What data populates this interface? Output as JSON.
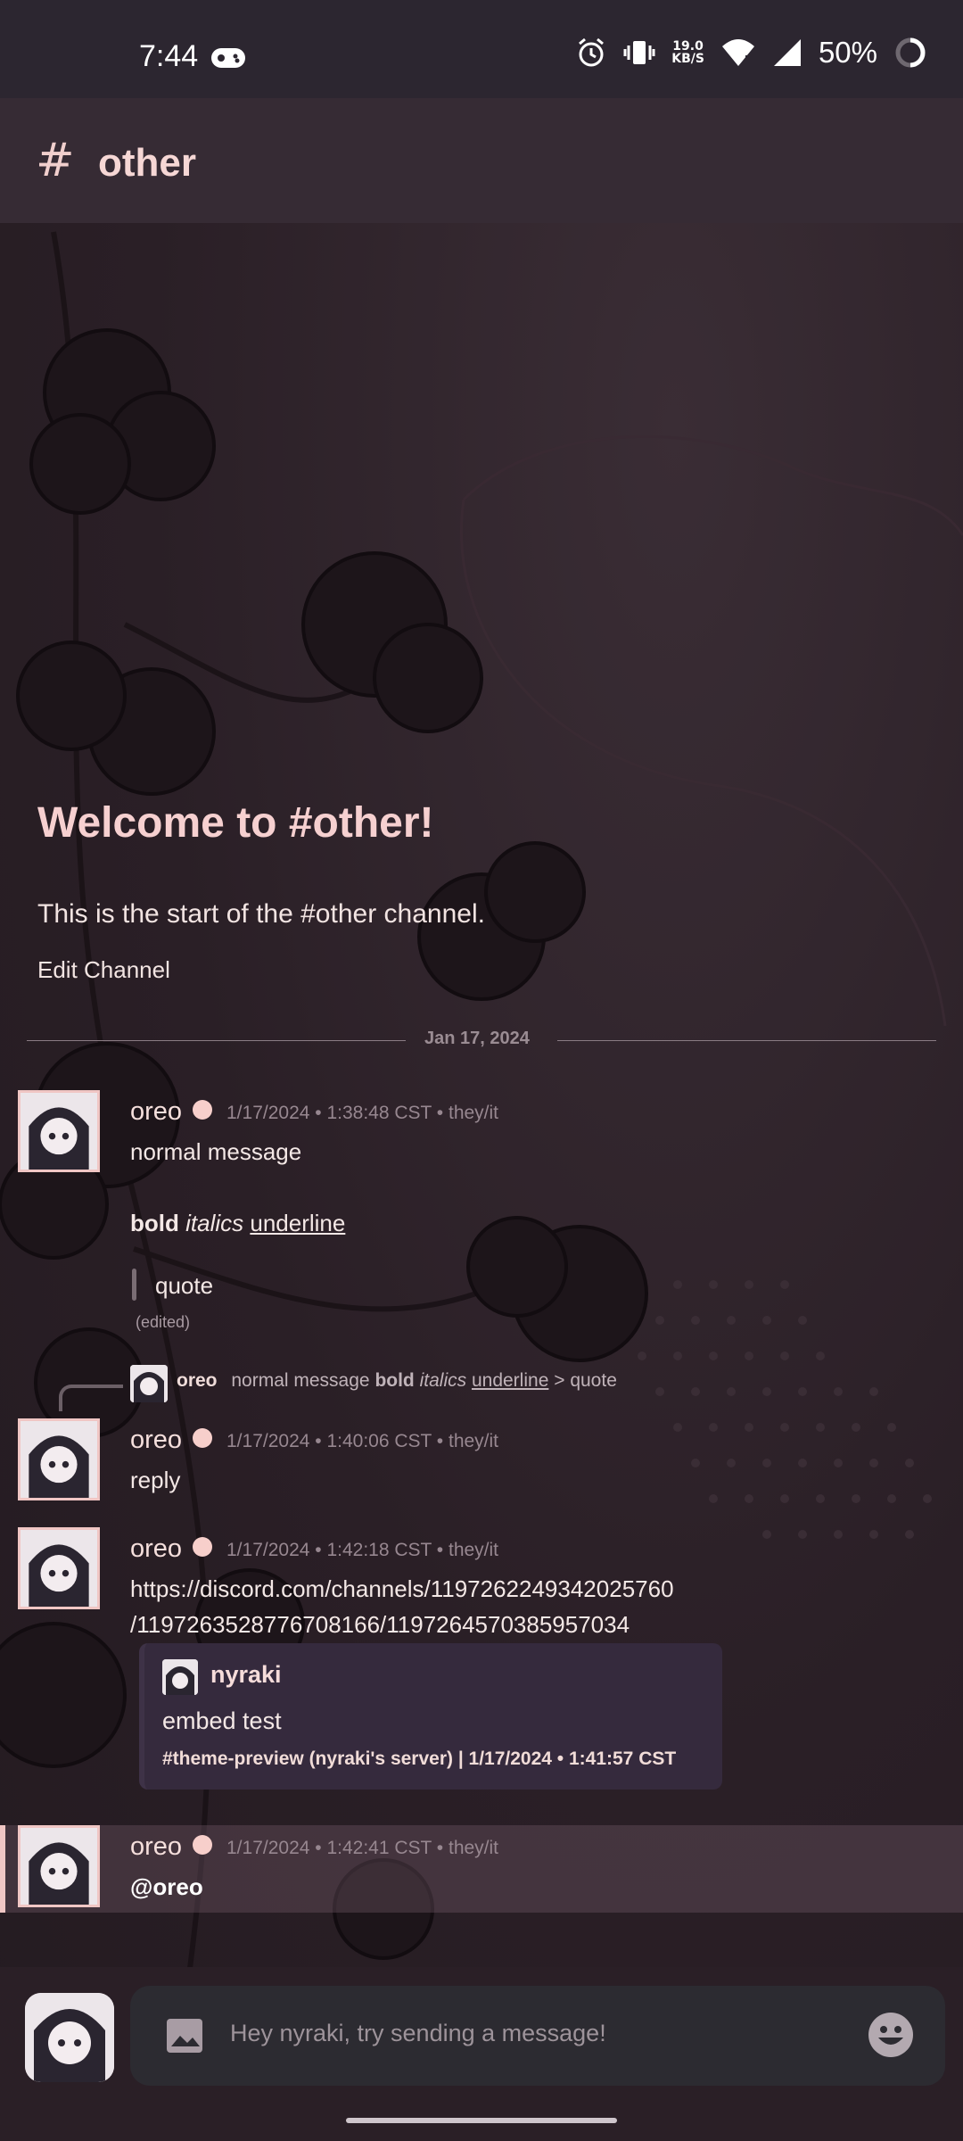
{
  "status_bar": {
    "time": "7:44",
    "net_speed_value": "19.0",
    "net_speed_unit": "KB/S",
    "battery": "50%"
  },
  "channel_header": {
    "hash": "#",
    "name": "other"
  },
  "welcome": {
    "title": "Welcome to #other!",
    "subtitle": "This is the start of the #other channel.",
    "edit_channel": "Edit Channel"
  },
  "date_divider": "Jan 17, 2024",
  "messages": [
    {
      "author": "oreo",
      "meta": "1/17/2024 • 1:38:48 CST • they/it",
      "lines": [
        "normal message"
      ],
      "formatted": {
        "bold": "bold",
        "italic": "italics",
        "underline": "underline"
      },
      "quote": "quote",
      "edited": "(edited)"
    },
    {
      "reply_to": {
        "author": "oreo",
        "preview_plain": "normal message",
        "preview_bold": "bold",
        "preview_italic": "italics",
        "preview_underline": "underline",
        "preview_tail": "> quote"
      },
      "author": "oreo",
      "meta": "1/17/2024 • 1:40:06 CST • they/it",
      "text": "reply"
    },
    {
      "author": "oreo",
      "meta": "1/17/2024 • 1:42:18 CST • they/it",
      "link_line1": "https://discord.com/channels/1197262249342025760",
      "link_line2": "/1197263528776708166/1197264570385957034",
      "embed": {
        "author": "nyraki",
        "description": "embed test",
        "footer": "#theme-preview (nyraki's server) | 1/17/2024 • 1:41:57 CST"
      }
    },
    {
      "author": "oreo",
      "meta": "1/17/2024 • 1:42:41 CST • they/it",
      "mention": "@oreo"
    }
  ],
  "composer": {
    "placeholder": "Hey nyraki, try sending a message!"
  },
  "colors": {
    "accent_pink": "#f0c6c4",
    "background": "#2a1f26",
    "header": "#362b34",
    "embed_bg": "#352a3d"
  }
}
